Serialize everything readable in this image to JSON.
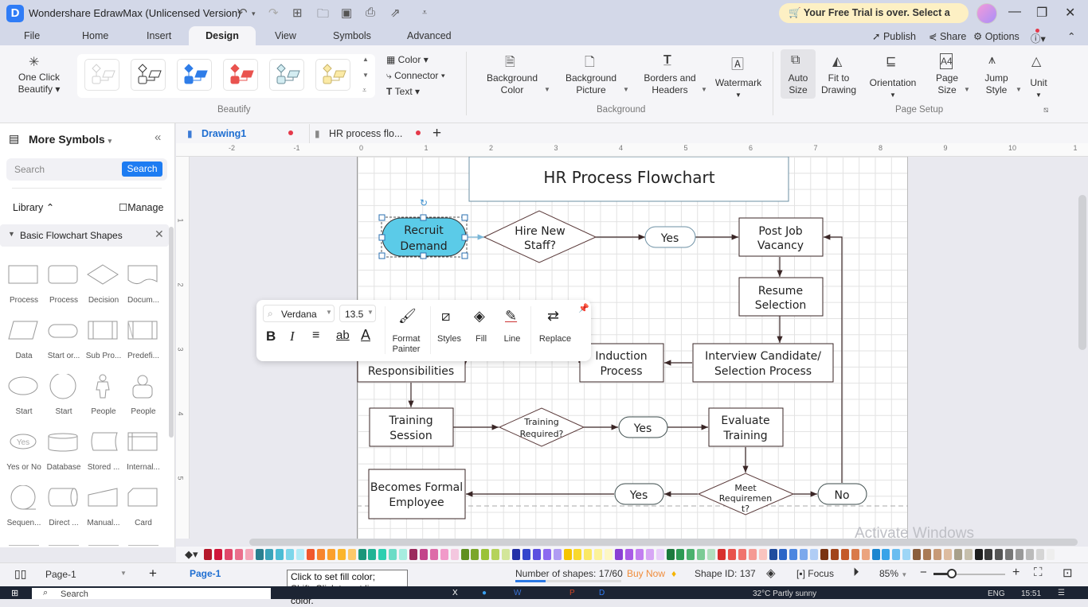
{
  "app": {
    "title": "Wondershare EdrawMax (Unlicensed Version)",
    "logo": "D"
  },
  "trial_banner": "Your Free Trial is over. Select a Plan",
  "menu": {
    "items": [
      "File",
      "Home",
      "Insert",
      "Design",
      "View",
      "Symbols",
      "Advanced"
    ],
    "active": "Design",
    "right": [
      "Publish",
      "Share",
      "Options"
    ]
  },
  "ribbon": {
    "one_click": "One Click\nBeautify",
    "one_click_l1": "One Click",
    "one_click_l2": "Beautify",
    "beautify_group": "Beautify",
    "side_cmds": [
      "Color",
      "Connector",
      "Text"
    ],
    "background": {
      "group": "Background",
      "items": [
        {
          "l1": "Background",
          "l2": "Color"
        },
        {
          "l1": "Background",
          "l2": "Picture"
        },
        {
          "l1": "Borders and",
          "l2": "Headers"
        },
        {
          "l1": "Watermark",
          "l2": ""
        }
      ]
    },
    "page_setup": {
      "group": "Page Setup",
      "items": [
        {
          "l1": "Auto",
          "l2": "Size"
        },
        {
          "l1": "Fit to",
          "l2": "Drawing"
        },
        {
          "l1": "Orientation",
          "l2": ""
        },
        {
          "l1": "Page",
          "l2": "Size"
        },
        {
          "l1": "Jump",
          "l2": "Style"
        },
        {
          "l1": "Unit",
          "l2": ""
        }
      ]
    },
    "themes": [
      {
        "stroke": "#cfcfcf",
        "fill": "#ffffff"
      },
      {
        "stroke": "#333333",
        "fill": "#ffffff"
      },
      {
        "stroke": "#2f7de8",
        "fill": "#2f7de8"
      },
      {
        "stroke": "#e9534f",
        "fill": "#e9534f"
      },
      {
        "stroke": "#6b8d99",
        "fill": "#d4edf2"
      },
      {
        "stroke": "#c9b46a",
        "fill": "#fbeaa6"
      }
    ]
  },
  "left_panel": {
    "title": "More Symbols",
    "search_placeholder": "Search",
    "search_button": "Search",
    "library": "Library",
    "manage": "Manage",
    "section": "Basic Flowchart Shapes",
    "shapes": [
      "Process",
      "Process",
      "Decision",
      "Docum...",
      "Data",
      "Start or...",
      "Sub Pro...",
      "Predefi...",
      "Start",
      "Start",
      "People",
      "People",
      "Yes or No",
      "Database",
      "Stored ...",
      "Internal...",
      "Sequen...",
      "Direct ...",
      "Manual...",
      "Card"
    ]
  },
  "tabs": [
    {
      "label": "Drawing1",
      "active": true
    },
    {
      "label": "HR process flo...",
      "active": false
    }
  ],
  "ruler": {
    "h": [
      "-2",
      "-1",
      "0",
      "1",
      "2",
      "3",
      "4",
      "5",
      "6",
      "7",
      "8",
      "9",
      "10",
      "1"
    ],
    "v": [
      "1",
      "2",
      "3",
      "4",
      "5"
    ]
  },
  "float_toolbar": {
    "font": "Verdana",
    "size": "13.5",
    "tools": [
      {
        "l1": "Format",
        "l2": "Painter"
      },
      {
        "l1": "Styles",
        "l2": ""
      },
      {
        "l1": "Fill",
        "l2": ""
      },
      {
        "l1": "Line",
        "l2": ""
      },
      {
        "l1": "Replace",
        "l2": ""
      }
    ]
  },
  "diagram": {
    "title": "HR Process Flowchart",
    "nodes": {
      "recruit": [
        "Recruit",
        "Demand"
      ],
      "hire": [
        "Hire New",
        "Staff?"
      ],
      "yes1": "Yes",
      "post": [
        "Post Job",
        "Vacancy"
      ],
      "resume": [
        "Resume",
        "Selection"
      ],
      "interview": [
        "Interview Candidate/",
        "Selection Process"
      ],
      "induction": [
        "Induction",
        "Process"
      ],
      "resp": "Responsibilities",
      "training": [
        "Training",
        "Session"
      ],
      "treq": [
        "Training",
        "Required?"
      ],
      "yes2": "Yes",
      "evaluate": [
        "Evaluate",
        "Training"
      ],
      "meet": [
        "Meet",
        "Requiremen",
        "t?"
      ],
      "yes3": "Yes",
      "no": "No",
      "formal": [
        "Becomes Formal",
        "Employee"
      ]
    },
    "selected_fill": "#5bcbe8"
  },
  "palette": [
    "#b5182b",
    "#d0163a",
    "#e0476a",
    "#ea6f8c",
    "#f4a6b8",
    "#2a7f8f",
    "#3aa3b9",
    "#4bbcd4",
    "#7dd6ea",
    "#b2ebf6",
    "#f0582c",
    "#f7852e",
    "#fba02d",
    "#fbb52c",
    "#fdc96a",
    "#1b9679",
    "#22b394",
    "#2ccfb0",
    "#6cdcc6",
    "#a6ede0",
    "#9b2a5d",
    "#c3458a",
    "#dd6ca8",
    "#f19ac9",
    "#f4c7df",
    "#5f8f1f",
    "#7ba62a",
    "#9ac238",
    "#b5d35a",
    "#d3e69a",
    "#2330a8",
    "#3346cc",
    "#5b4fe0",
    "#8c6af0",
    "#b09cf3",
    "#f5c400",
    "#f9d92d",
    "#fbe865",
    "#fcf299",
    "#fdf7c4",
    "#8a3fd4",
    "#a95be6",
    "#c27ef0",
    "#d7a6f5",
    "#e8cef9",
    "#1c7a3d",
    "#2d9a54",
    "#4bb16e",
    "#7ccb95",
    "#b2e0bf",
    "#d8302e",
    "#e8524c",
    "#f0736d",
    "#f59a94",
    "#fac4bf",
    "#1f4c9e",
    "#2c65c7",
    "#4c86e0",
    "#7ca8ec",
    "#b0cdf5",
    "#7a3311",
    "#a1441a",
    "#c45a2a",
    "#d97a4a",
    "#eba47e",
    "#1a86d0",
    "#37a3e8",
    "#6bbdf0",
    "#9ed6f6",
    "#8b5e3c",
    "#a97b56",
    "#c79a77",
    "#ddbca0",
    "#a8a08a",
    "#c6bfac",
    "#1e1e1e",
    "#3a3a3a",
    "#555555",
    "#777777",
    "#999999",
    "#bbbbbb",
    "#d5d5d5",
    "#eeeeee"
  ],
  "status": {
    "page_select": "Page-1",
    "page_tab": "Page-1",
    "tooltip_l1": "Click to set fill color;",
    "tooltip_l2": "Shift+Click to set line color.",
    "shapes_count": "Number of shapes: 17/60",
    "buy_now": "Buy Now",
    "shape_id": "Shape ID: 137",
    "focus": "Focus",
    "zoom": "85%",
    "zoom_level": 0.25
  },
  "watermark": "Activate Windows",
  "taskbar": {
    "search": "Search",
    "weather": "32°C  Partly sunny",
    "lang": "ENG",
    "time": "15:51"
  }
}
